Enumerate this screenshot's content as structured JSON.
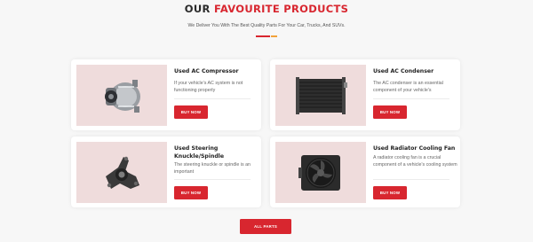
{
  "section": {
    "title_dark": "OUR",
    "title_accent": "FAVOURITE PRODUCTS",
    "subtitle": "We Deliver You With The Best Quality Parts For Your Car, Trucks, And SUVs.",
    "accent_color": "#d8262f",
    "accent_secondary": "#f2a23a"
  },
  "products": [
    {
      "title": "Used AC Compressor",
      "description": "If your vehicle's AC system is not functioning properly",
      "button_label": "BUY NOW",
      "image_icon": "ac-compressor-image"
    },
    {
      "title": "Used AC Condenser",
      "description": "The AC condenser is an essential component of your vehicle's",
      "button_label": "BUY NOW",
      "image_icon": "ac-condenser-image"
    },
    {
      "title": "Used Steering Knuckle/Spindle",
      "description": "The steering knuckle or spindle is an important",
      "button_label": "BUY NOW",
      "image_icon": "steering-knuckle-image"
    },
    {
      "title": "Used Radiator Cooling Fan",
      "description": "A radiator cooling fan is a crucial component of a vehicle's cooling system",
      "button_label": "BUY NOW",
      "image_icon": "radiator-fan-image"
    }
  ],
  "all_parts_label": "ALL PARTS"
}
